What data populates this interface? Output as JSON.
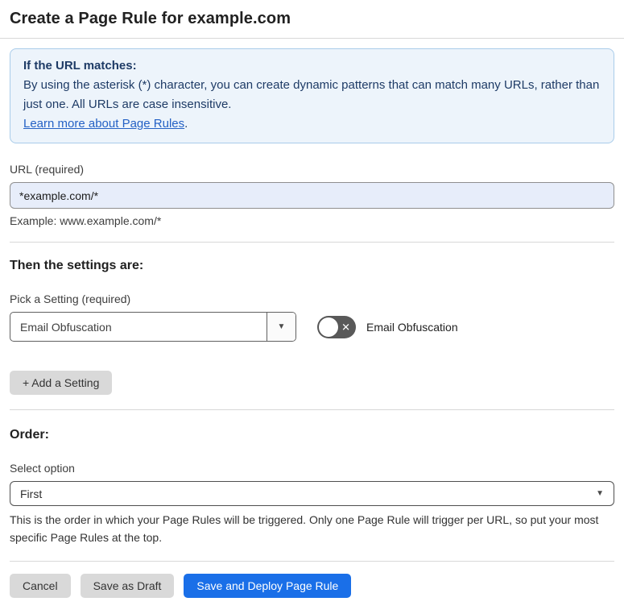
{
  "page": {
    "title": "Create a Page Rule for example.com"
  },
  "info_box": {
    "heading": "If the URL matches:",
    "body": "By using the asterisk (*) character, you can create dynamic patterns that can match many URLs, rather than just one. All URLs are case insensitive.",
    "link_text": "Learn more about Page Rules",
    "link_suffix": "."
  },
  "url_field": {
    "label": "URL (required)",
    "value": "*example.com/*",
    "example": "Example: www.example.com/*"
  },
  "settings_section": {
    "heading": "Then the settings are:",
    "pick_label": "Pick a Setting (required)",
    "selected_setting": "Email Obfuscation",
    "toggle_label": "Email Obfuscation",
    "toggle_state": "off",
    "add_button_label": "+ Add a Setting"
  },
  "order_section": {
    "heading": "Order:",
    "label": "Select option",
    "selected_option": "First",
    "help_text": "This is the order in which your Page Rules will be triggered. Only one Page Rule will trigger per URL, so put your most specific Page Rules at the top."
  },
  "footer": {
    "cancel_label": "Cancel",
    "save_draft_label": "Save as Draft",
    "save_deploy_label": "Save and Deploy Page Rule"
  },
  "icons": {
    "dropdown_arrow": "▼",
    "toggle_off_x": "✕"
  },
  "colors": {
    "primary_blue": "#1A6FE8",
    "info_bg": "#EDF4FB",
    "info_border": "#A9CCEA",
    "info_text": "#1E3B66",
    "link_blue": "#2461C5",
    "input_bg": "#E7EDFA",
    "toggle_off_bg": "#595959",
    "gray_button_bg": "#D9D9D9"
  }
}
